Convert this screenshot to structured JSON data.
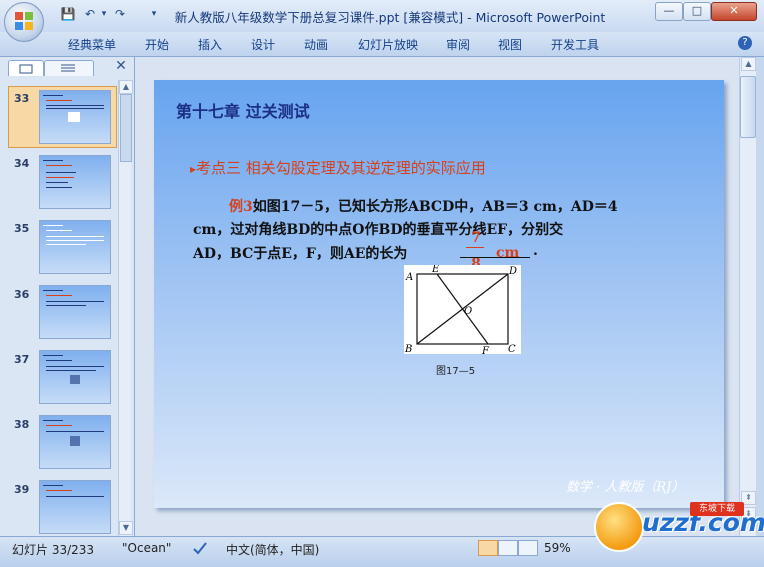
{
  "window": {
    "title": "新人教版八年级数学下册总复习课件.ppt [兼容模式] - Microsoft PowerPoint",
    "controls": {
      "minimize": "—",
      "maximize": "□",
      "close": "✕"
    }
  },
  "quick_access": {
    "save": "💾",
    "undo": "↶",
    "redo": "↷",
    "more": "▾"
  },
  "ribbon": {
    "tabs": [
      "经典菜单",
      "开始",
      "插入",
      "设计",
      "动画",
      "幻灯片放映",
      "审阅",
      "视图",
      "开发工具"
    ],
    "help": "?"
  },
  "slides_panel": {
    "close": "✕",
    "thumbnails": [
      {
        "number": "33",
        "selected": true
      },
      {
        "number": "34",
        "selected": false
      },
      {
        "number": "35",
        "selected": false
      },
      {
        "number": "36",
        "selected": false
      },
      {
        "number": "37",
        "selected": false
      },
      {
        "number": "38",
        "selected": false
      },
      {
        "number": "39",
        "selected": false
      }
    ]
  },
  "slide": {
    "chapter_title": "第十七章  过关测试",
    "section_marker": "▸",
    "section_title": "考点三   相关勾股定理及其逆定理的实际应用",
    "example_label": "例3",
    "line1": "如图17－5，已知长方形ABCD中，AB＝3 cm，AD＝4",
    "line2": "cm，过对角线BD的中点O作BD的垂直平分线EF，分别交",
    "line3": "AD，BC于点E，F，则AE的长为",
    "answer_numerator": "7",
    "answer_denominator": "8",
    "answer_unit": "cm",
    "answer_end": ".",
    "figure_labels": {
      "A": "A",
      "B": "B",
      "C": "C",
      "D": "D",
      "E": "E",
      "F": "F",
      "O": "O"
    },
    "figure_caption": "图17—5",
    "footer": "数学 · 人教版（RJ）"
  },
  "status_bar": {
    "slide_indicator": "幻灯片 33/233",
    "theme": "\"Ocean\"",
    "language": "中文(简体，中国)",
    "zoom": "59%"
  },
  "watermark": {
    "text": "uzzf.com",
    "badge": "东坡下载"
  },
  "colors": {
    "accent_red": "#d6401b",
    "title_blue": "#1c2f86",
    "slide_top": "#67a4ef",
    "slide_bottom": "#dbe8f9"
  }
}
